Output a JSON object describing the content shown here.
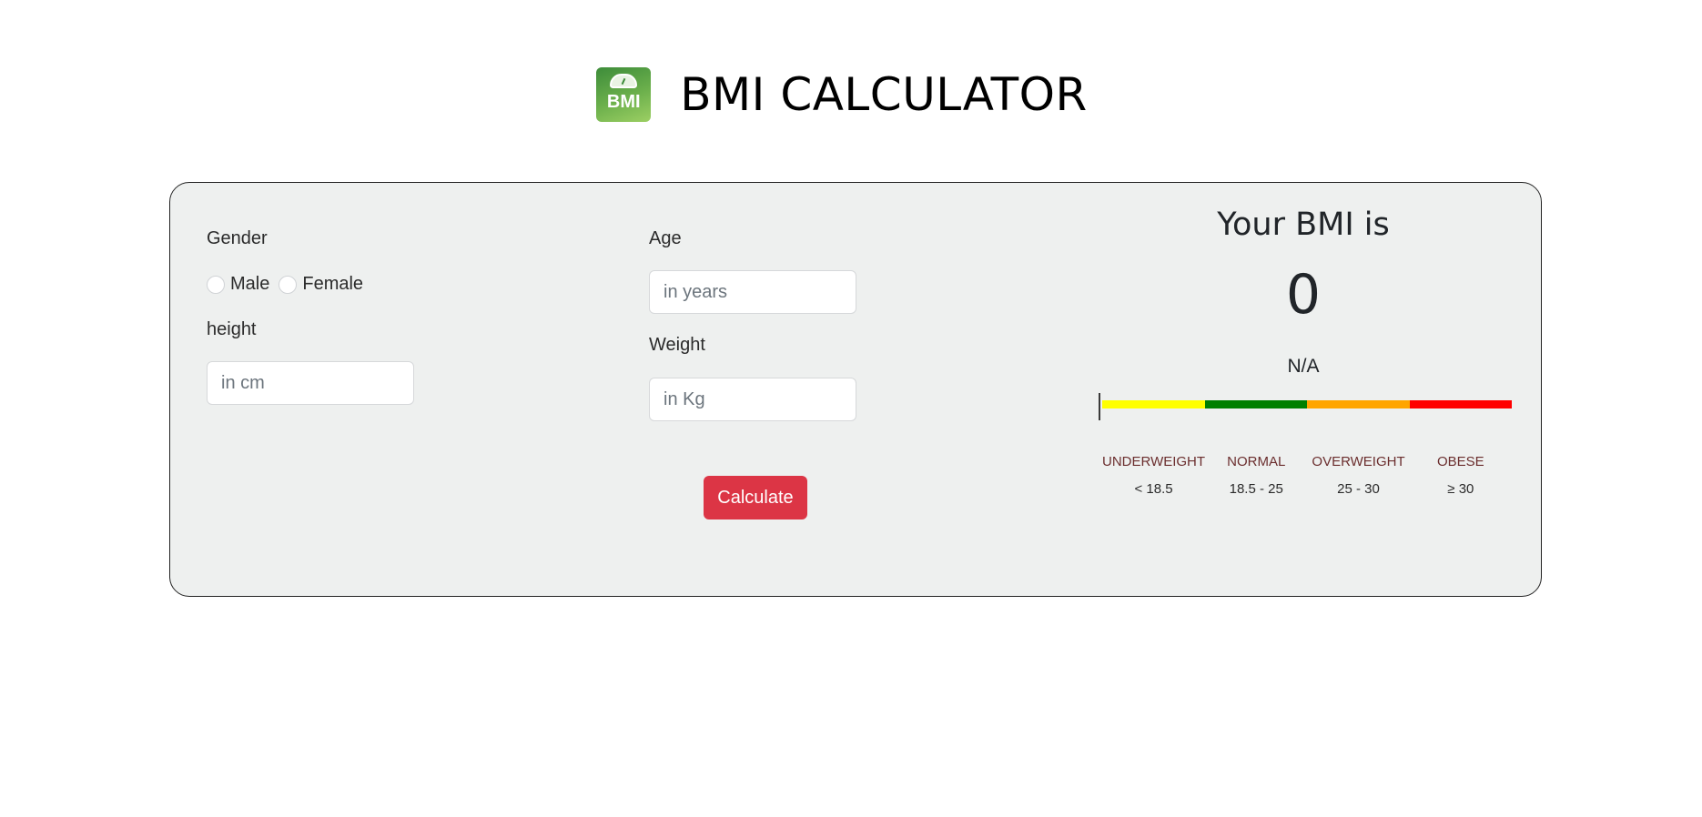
{
  "header": {
    "logo_text": "BMI",
    "title": "BMI CALCULATOR"
  },
  "form": {
    "gender_label": "Gender",
    "gender_options": [
      "Male",
      "Female"
    ],
    "height_label": "height",
    "height_placeholder": "in cm",
    "age_label": "Age",
    "age_placeholder": "in years",
    "weight_label": "Weight",
    "weight_placeholder": "in Kg",
    "calculate_label": "Calculate"
  },
  "result": {
    "heading": "Your BMI is",
    "value": "0",
    "category": "N/A",
    "marker_fraction": 0,
    "scale": [
      {
        "name": "UNDERWEIGHT",
        "range": "< 18.5",
        "color": "#ffff00"
      },
      {
        "name": "NORMAL",
        "range": "18.5 - 25",
        "color": "#008000"
      },
      {
        "name": "OVERWEIGHT",
        "range": "25 - 30",
        "color": "#ffa500"
      },
      {
        "name": "OBESE",
        "range": "≥ 30",
        "color": "#ff0000"
      }
    ]
  },
  "colors": {
    "card_background": "#eef0ef",
    "button": "#dc3545",
    "range_label": "#6b2e2e"
  }
}
